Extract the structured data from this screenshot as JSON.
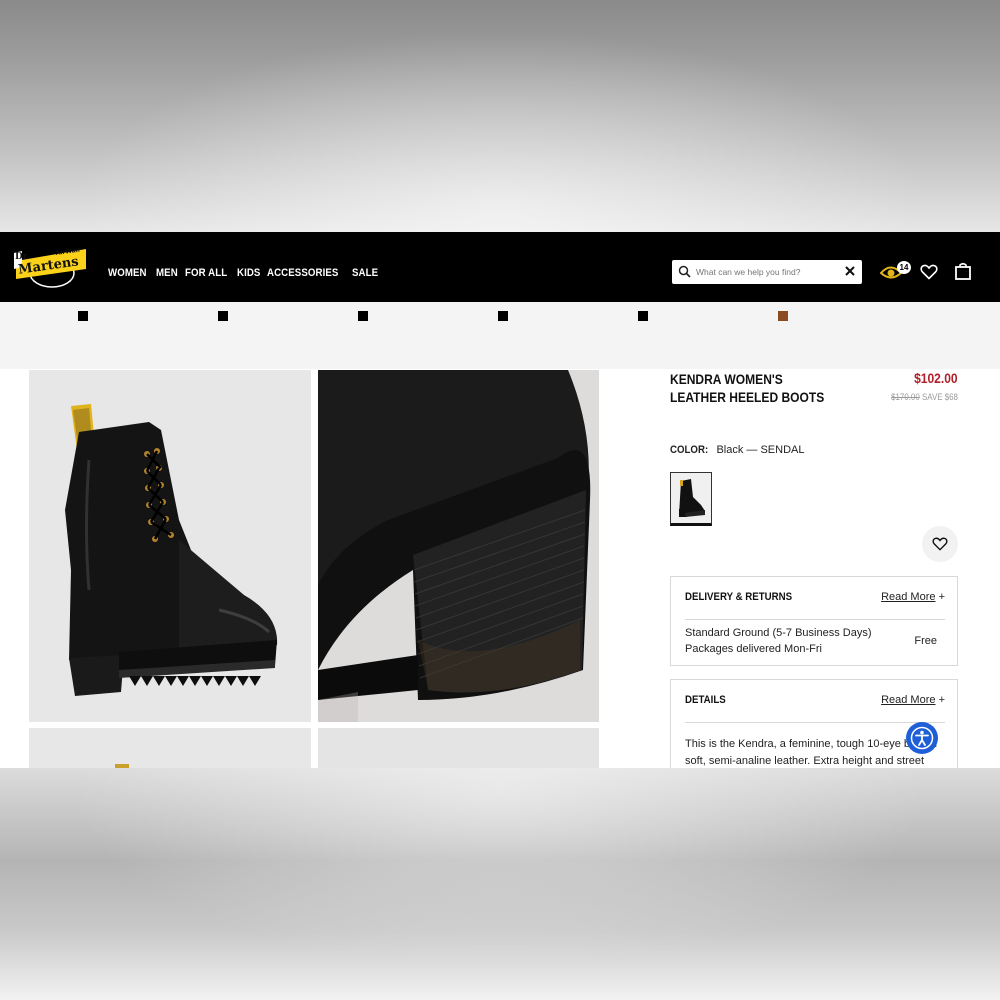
{
  "brand": {
    "logo_alt": "Dr. Martens",
    "logo_text_top": "Dr.",
    "logo_text_main": "Martens",
    "logo_text_small": "AirWair"
  },
  "nav": {
    "items": [
      "WOMEN",
      "MEN",
      "FOR ALL",
      "KIDS",
      "ACCESSORIES",
      "SALE"
    ]
  },
  "search": {
    "placeholder": "What can we help you find?",
    "icon": "search-icon",
    "clear_icon": "close-icon"
  },
  "header_icons": {
    "eye_badge": "14",
    "eye_icon": "eye-icon",
    "wishlist_icon": "heart-icon",
    "bag_icon": "shopping-bag-icon"
  },
  "swatch_strip": {
    "colors": [
      "#000000",
      "#000000",
      "#000000",
      "#000000",
      "#000000",
      "#8b4a1f"
    ]
  },
  "product": {
    "title": "KENDRA WOMEN'S LEATHER HEELED BOOTS",
    "price": "$102.00",
    "was_price": "$170.00",
    "save_text": "SAVE $68",
    "price_color": "#b0202a"
  },
  "color": {
    "label": "COLOR:",
    "value": "Black — SENDAL"
  },
  "delivery": {
    "title": "DELIVERY & RETURNS",
    "link": "Read More",
    "link_plus": "+",
    "line1": "Standard Ground (5-7 Business Days)",
    "line2": "Packages delivered Mon-Fri",
    "cost": "Free"
  },
  "details": {
    "title": "DETAILS",
    "link": "Read More",
    "link_plus": "+",
    "text": "This is the Kendra, a feminine, tough 10-eye boot in soft, semi-analine leather. Extra height and street"
  },
  "accessibility": {
    "icon": "accessibility-icon"
  }
}
